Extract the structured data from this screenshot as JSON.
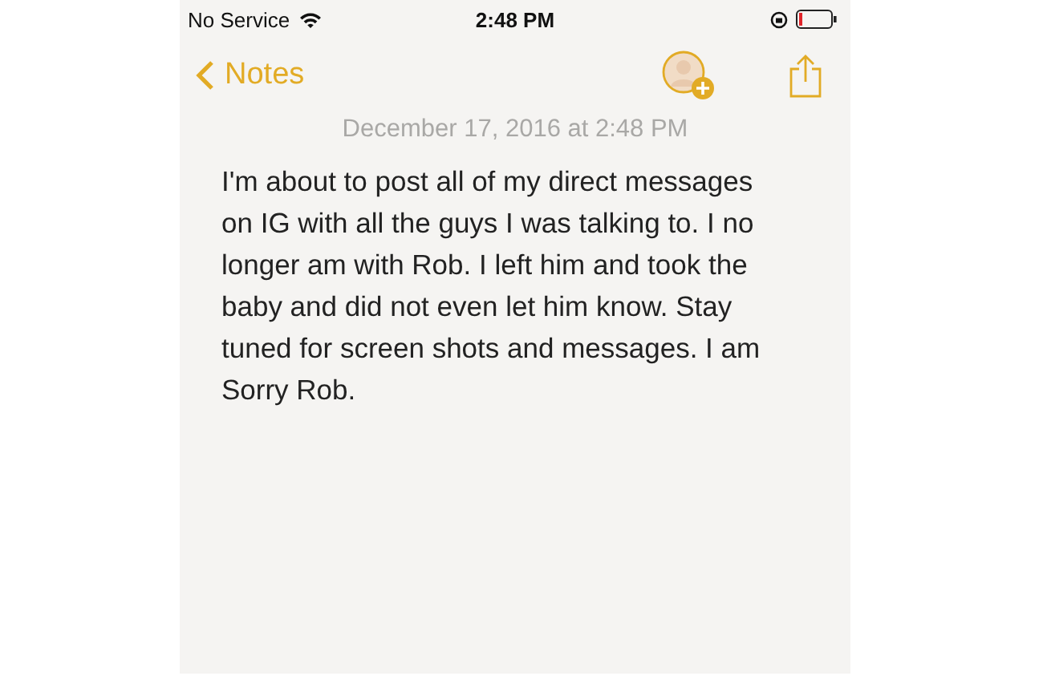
{
  "status_bar": {
    "carrier": "No Service",
    "time": "2:48 PM"
  },
  "nav": {
    "back_label": "Notes"
  },
  "note": {
    "date": "December 17, 2016 at 2:48 PM",
    "body": "I'm about to post all of my direct messages on IG with all the guys I was talking to. I no longer am with Rob. I left him and took the baby and did not even let him know. Stay tuned for screen shots and messages. I am Sorry Rob."
  }
}
